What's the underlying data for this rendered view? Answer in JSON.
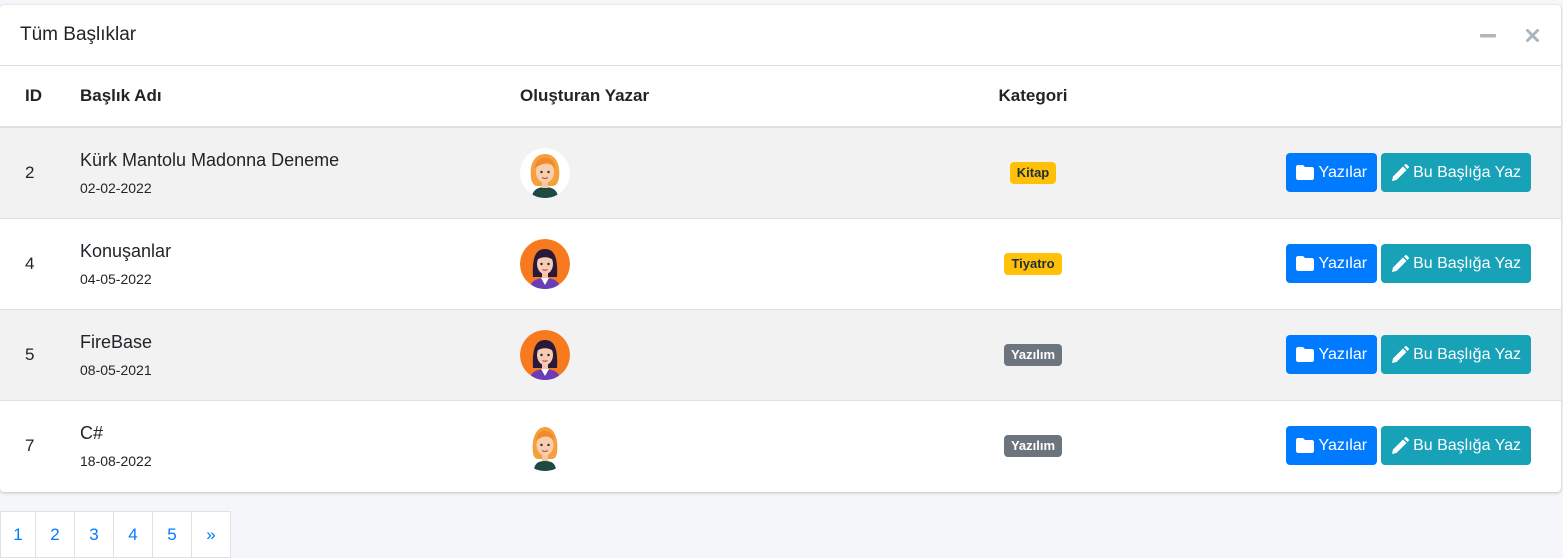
{
  "card": {
    "title": "Tüm Başlıklar",
    "minimize_icon": "minus-icon",
    "close_icon": "times-icon"
  },
  "table": {
    "headers": {
      "id": "ID",
      "title": "Başlık Adı",
      "author": "Oluşturan Yazar",
      "category": "Kategori"
    },
    "rows": [
      {
        "id": "2",
        "title": "Kürk Mantolu Madonna Deneme",
        "date": "02-02-2022",
        "avatar": "blonde-woman-avatar-white-bg",
        "category": "Kitap",
        "category_style": "warning",
        "btn_posts": "Yazılar",
        "btn_write": "Bu Başlığa Yaz"
      },
      {
        "id": "4",
        "title": "Konuşanlar",
        "date": "04-05-2022",
        "avatar": "dark-hair-woman-avatar-orange-bg",
        "category": "Tiyatro",
        "category_style": "warning",
        "btn_posts": "Yazılar",
        "btn_write": "Bu Başlığa Yaz"
      },
      {
        "id": "5",
        "title": "FireBase",
        "date": "08-05-2021",
        "avatar": "dark-hair-woman-avatar-orange-bg",
        "category": "Yazılım",
        "category_style": "secondary",
        "btn_posts": "Yazılar",
        "btn_write": "Bu Başlığa Yaz"
      },
      {
        "id": "7",
        "title": "C#",
        "date": "18-08-2022",
        "avatar": "blonde-woman-avatar-white-bg",
        "category": "Yazılım",
        "category_style": "secondary",
        "btn_posts": "Yazılar",
        "btn_write": "Bu Başlığa Yaz"
      }
    ]
  },
  "pagination": {
    "pages": [
      "1",
      "2",
      "3",
      "4",
      "5"
    ],
    "next": "»"
  },
  "colors": {
    "primary": "#007bff",
    "info": "#17a2b8",
    "warning": "#ffc107",
    "secondary": "#6c757d",
    "avatar_orange": "#f77a1f",
    "avatar_purple": "#6a3fb5"
  }
}
